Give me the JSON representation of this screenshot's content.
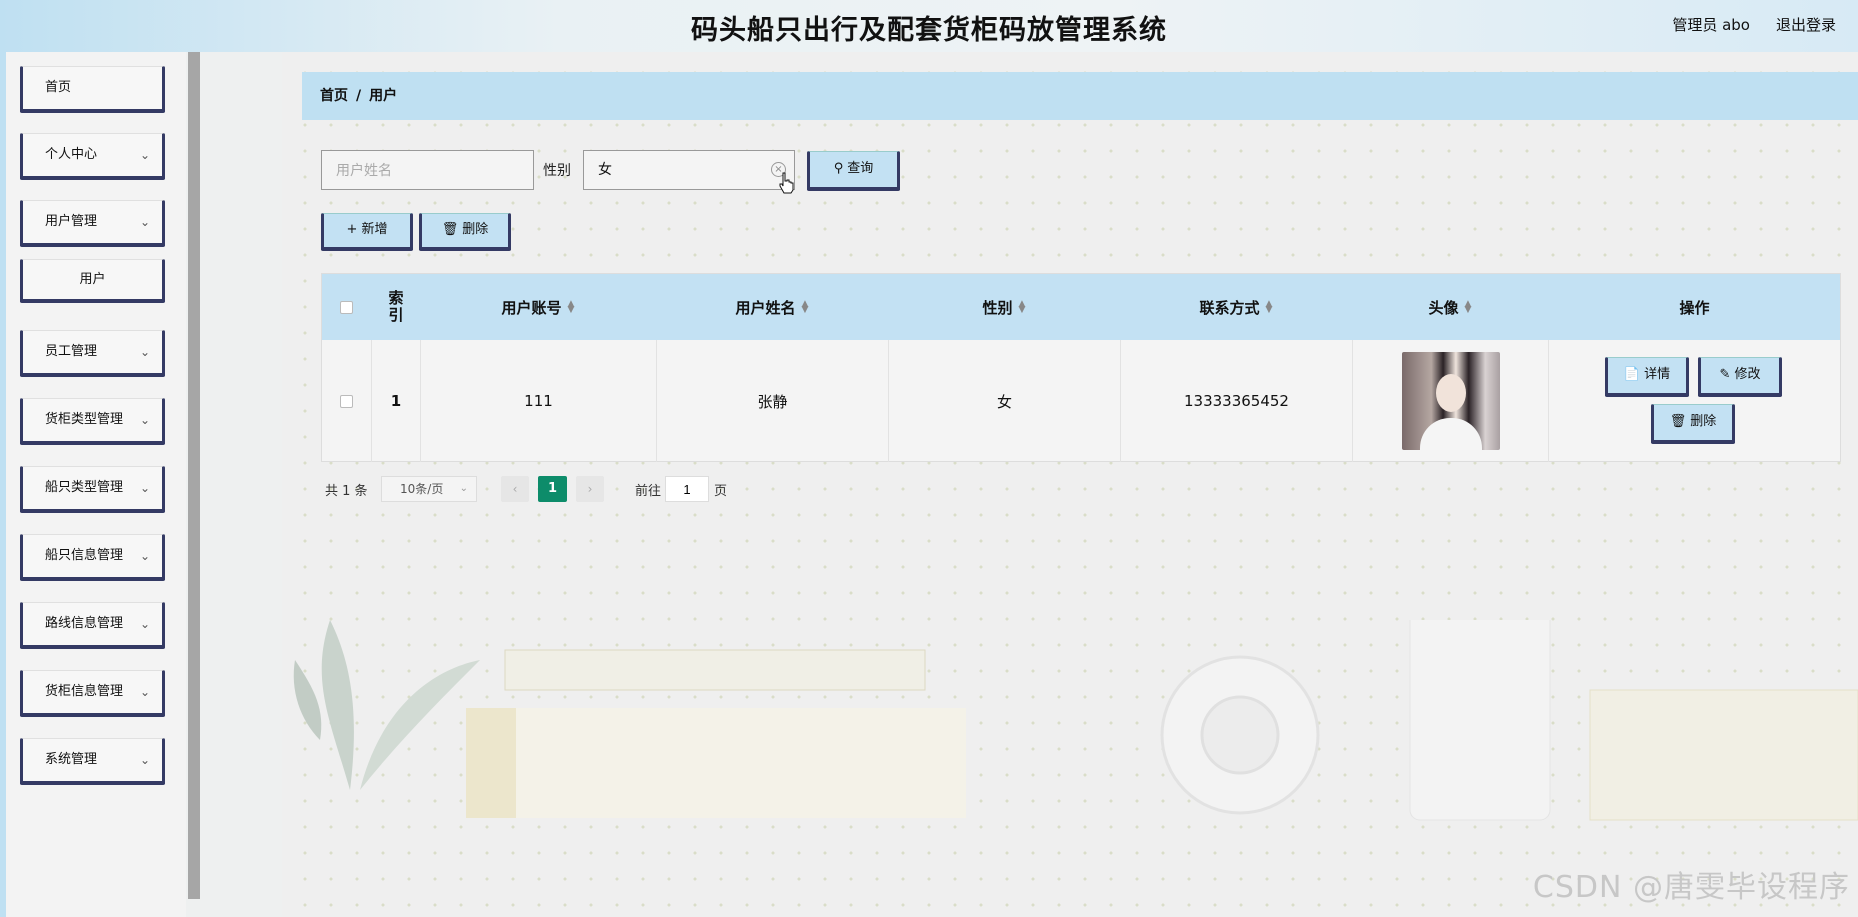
{
  "header": {
    "title": "码头船只出行及配套货柜码放管理系统",
    "user": "管理员 abo",
    "logout": "退出登录"
  },
  "sidebar": {
    "items": [
      {
        "label": "首页",
        "has_chevron": false
      },
      {
        "label": "个人中心",
        "has_chevron": true
      },
      {
        "label": "用户管理",
        "has_chevron": true
      },
      {
        "label": "用户",
        "has_chevron": false,
        "sub": true
      },
      {
        "label": "员工管理",
        "has_chevron": true
      },
      {
        "label": "货柜类型管理",
        "has_chevron": true
      },
      {
        "label": "船只类型管理",
        "has_chevron": true
      },
      {
        "label": "船只信息管理",
        "has_chevron": true
      },
      {
        "label": "路线信息管理",
        "has_chevron": true
      },
      {
        "label": "货柜信息管理",
        "has_chevron": true
      },
      {
        "label": "系统管理",
        "has_chevron": true
      }
    ]
  },
  "breadcrumb": {
    "home": "首页",
    "separator": "/",
    "current": "用户"
  },
  "search": {
    "name_placeholder": "用户姓名",
    "name_value": "",
    "gender_label": "性别",
    "gender_value": "女",
    "query_button": "查询"
  },
  "actions": {
    "add": "新增",
    "delete": "删除"
  },
  "table": {
    "columns": [
      "索引",
      "用户账号",
      "用户姓名",
      "性别",
      "联系方式",
      "头像",
      "操作"
    ],
    "rows": [
      {
        "index": "1",
        "account": "111",
        "name": "张静",
        "gender": "女",
        "phone": "13333365452",
        "actions": {
          "detail": "详情",
          "edit": "修改",
          "delete": "删除"
        }
      }
    ]
  },
  "pagination": {
    "total": "共 1 条",
    "page_size": "10条/页",
    "current_page": "1",
    "goto_label": "前往",
    "goto_value": "1",
    "page_unit": "页"
  },
  "watermark": "CSDN @唐雯毕设程序",
  "colors": {
    "accent": "#bfe0f2",
    "button_border": "#343a64",
    "page_active": "#0d8c6a"
  }
}
